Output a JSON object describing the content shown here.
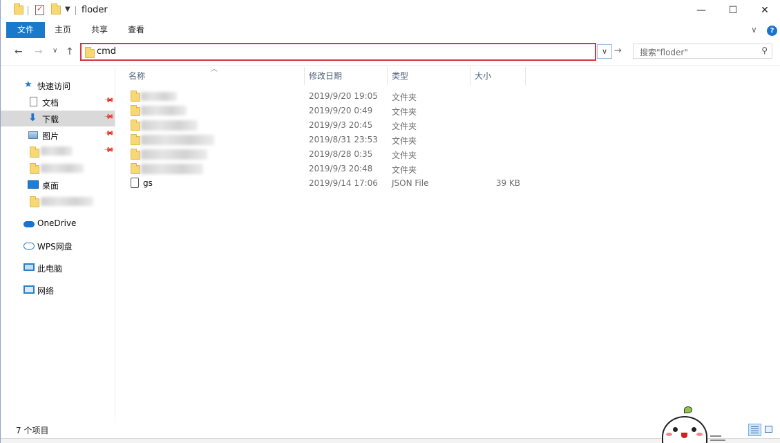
{
  "window": {
    "title": "floder",
    "controls": {
      "minimize": "—",
      "maximize": "☐",
      "close": "✕"
    }
  },
  "ribbon": {
    "tabs": [
      {
        "label": "文件"
      },
      {
        "label": "主页"
      },
      {
        "label": "共享"
      },
      {
        "label": "查看"
      }
    ],
    "help": "?"
  },
  "address_bar": {
    "path": "cmd",
    "dropdown": "∨",
    "go": "→"
  },
  "search": {
    "placeholder": "搜索\"floder\"",
    "icon": "search-icon"
  },
  "nav_pane": {
    "quick_access": "快速访问",
    "items": [
      {
        "label": "文档",
        "icon": "document-icon",
        "pinned": true
      },
      {
        "label": "下载",
        "icon": "download-icon",
        "pinned": true,
        "selected": true
      },
      {
        "label": "图片",
        "icon": "pictures-icon",
        "pinned": true
      },
      {
        "label": "",
        "icon": "folder-icon",
        "pinned": true,
        "redacted": true
      },
      {
        "label": "",
        "icon": "folder-icon",
        "pinned": false,
        "redacted": true
      },
      {
        "label": "桌面",
        "icon": "desktop-icon",
        "pinned": false
      },
      {
        "label": "",
        "icon": "folder-icon",
        "pinned": false,
        "redacted": true
      }
    ],
    "onedrive": "OneDrive",
    "wps": "WPS网盘",
    "this_pc": "此电脑",
    "network": "网络"
  },
  "file_list": {
    "columns": {
      "name": "名称",
      "modified": "修改日期",
      "type": "类型",
      "size": "大小"
    },
    "rows": [
      {
        "name": "",
        "modified": "2019/9/20 19:05",
        "type": "文件夹",
        "size": "",
        "icon": "folder-icon",
        "redacted": true
      },
      {
        "name": "",
        "modified": "2019/9/20 0:49",
        "type": "文件夹",
        "size": "",
        "icon": "folder-icon",
        "redacted": true
      },
      {
        "name": "",
        "modified": "2019/9/3 20:45",
        "type": "文件夹",
        "size": "",
        "icon": "folder-icon",
        "redacted": true
      },
      {
        "name": "",
        "modified": "2019/8/31 23:53",
        "type": "文件夹",
        "size": "",
        "icon": "folder-icon",
        "redacted": true
      },
      {
        "name": "",
        "modified": "2019/8/28 0:35",
        "type": "文件夹",
        "size": "",
        "icon": "folder-icon",
        "redacted": true
      },
      {
        "name": "",
        "modified": "2019/9/3 20:48",
        "type": "文件夹",
        "size": "",
        "icon": "folder-icon",
        "redacted": true
      },
      {
        "name": "gs",
        "modified": "2019/9/14 17:06",
        "type": "JSON File",
        "size": "39 KB",
        "icon": "json-file-icon"
      }
    ]
  },
  "status_bar": {
    "item_count": "7 个项目"
  },
  "colors": {
    "file_tab": "#1979ca",
    "highlight_border": "#d9333f",
    "selected_nav": "#d9d9d9",
    "folder": "#f8d775"
  }
}
